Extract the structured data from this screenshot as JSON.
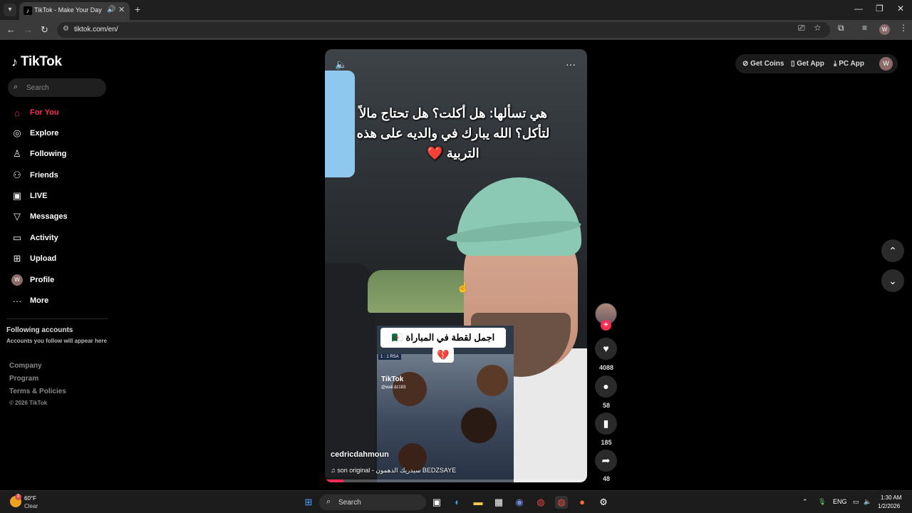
{
  "browser": {
    "tab_title": "TikTok - Make Your Day",
    "url": "tiktok.com/en/",
    "profile_initial": "W"
  },
  "brand": {
    "logo_text": "TikTok"
  },
  "search": {
    "placeholder": "Search"
  },
  "sidebar": {
    "items": [
      {
        "label": "For You",
        "icon": "home-icon",
        "active": true
      },
      {
        "label": "Explore",
        "icon": "compass-icon"
      },
      {
        "label": "Following",
        "icon": "user-follow-icon"
      },
      {
        "label": "Friends",
        "icon": "friends-icon"
      },
      {
        "label": "LIVE",
        "icon": "live-icon"
      },
      {
        "label": "Messages",
        "icon": "send-icon"
      },
      {
        "label": "Activity",
        "icon": "chat-icon"
      },
      {
        "label": "Upload",
        "icon": "plus-box-icon"
      },
      {
        "label": "Profile",
        "icon": "avatar"
      },
      {
        "label": "More",
        "icon": "ellipsis-icon"
      }
    ],
    "avatar_initial": "W",
    "following_title": "Following accounts",
    "following_desc": "Accounts you follow will appear here",
    "footer": [
      "Company",
      "Program",
      "Terms & Policies"
    ],
    "copyright": "© 2026 TikTok"
  },
  "topbar": {
    "get_coins": "Get Coins",
    "get_app": "Get App",
    "pc_app": "PC App",
    "avatar_initial": "W"
  },
  "video": {
    "caption": "هي تسألها: هل أكلت؟ هل تحتاج مالاً لتأكل؟ الله يبارك في والديه على هذه التربية ❤️",
    "inset_title": "اجمل لقطة في المباراة 🇩🇿",
    "inset_heart": "💔",
    "inset_score": "1 : 1 RSA",
    "inset_watermark": "TikTok",
    "inset_handle": "@wall.dz183",
    "username": "cedricdahmoun",
    "sound": "son original - سيدريك الدهمون BEDZSAYE",
    "progress": 0.07
  },
  "actions": {
    "likes": "4088",
    "comments": "58",
    "saves": "185",
    "shares": "48"
  },
  "taskbar": {
    "weather_temp": "60°F",
    "weather_desc": "Clear",
    "weather_badge": "3",
    "search_label": "Search",
    "lang": "ENG",
    "time": "1:30 AM",
    "date": "1/2/2026"
  },
  "colors": {
    "accent": "#fe2c55",
    "bg": "#000000"
  }
}
